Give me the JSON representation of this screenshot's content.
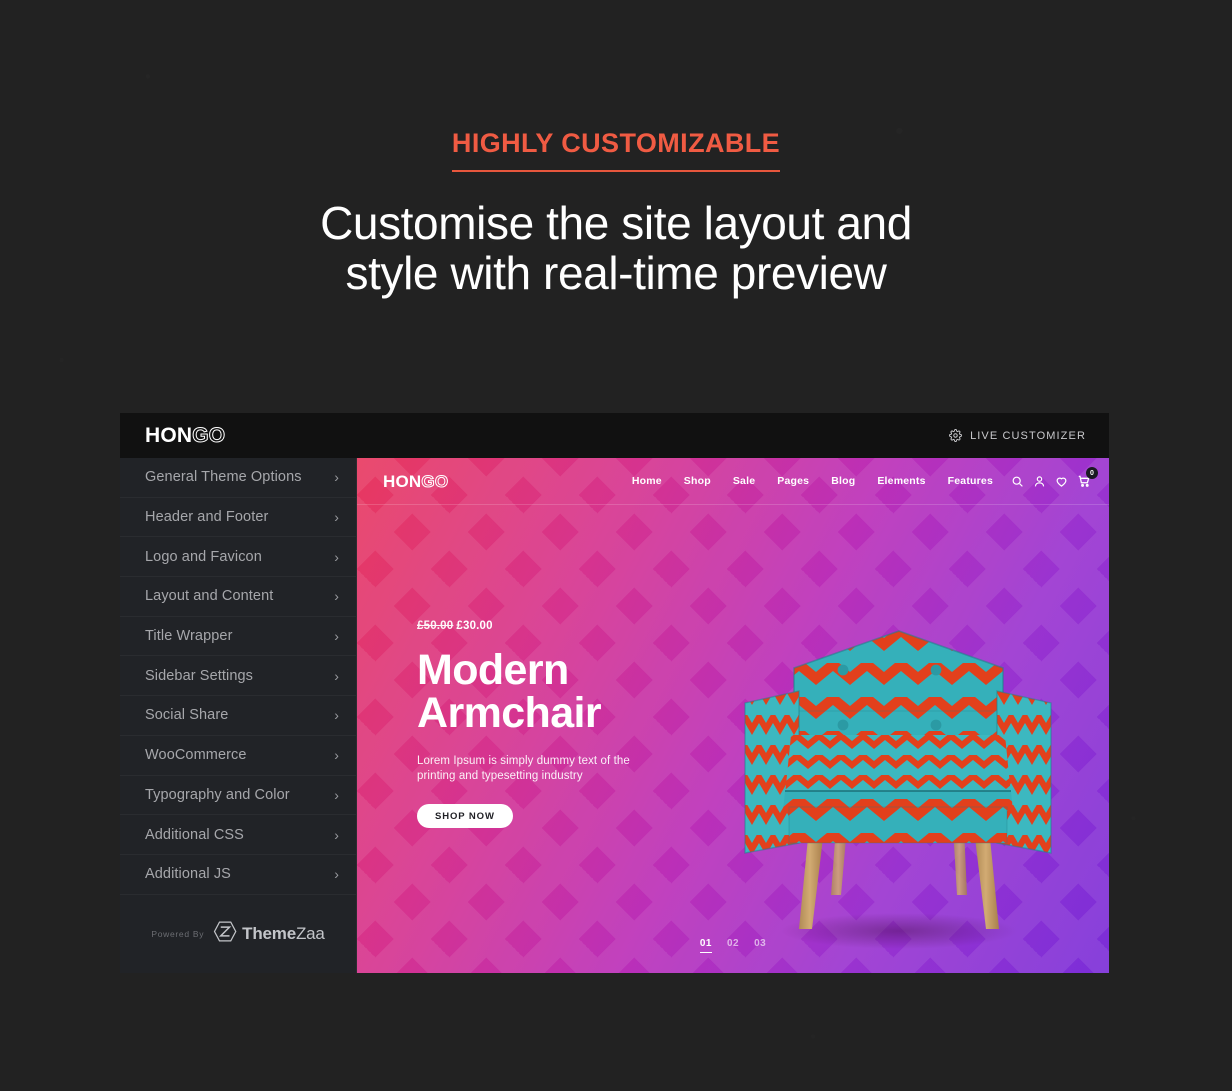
{
  "hero": {
    "eyebrow": "HIGHLY CUSTOMIZABLE",
    "headline_line1": "Customise the site layout and",
    "headline_line2": "style with real-time preview",
    "accent_color": "#f05b43"
  },
  "customizer": {
    "brand": {
      "bold": "HON",
      "outline": "GO"
    },
    "live_customizer_label": "LIVE CUSTOMIZER",
    "gear_icon": "gear-icon",
    "menu": [
      {
        "label": "General Theme Options",
        "chevron": "›"
      },
      {
        "label": "Header and Footer",
        "chevron": "›"
      },
      {
        "label": "Logo and Favicon",
        "chevron": "›"
      },
      {
        "label": "Layout and Content",
        "chevron": "›"
      },
      {
        "label": "Title Wrapper",
        "chevron": "›"
      },
      {
        "label": "Sidebar Settings",
        "chevron": "›"
      },
      {
        "label": "Social Share",
        "chevron": "›"
      },
      {
        "label": "WooCommerce",
        "chevron": "›"
      },
      {
        "label": "Typography and Color",
        "chevron": "›"
      },
      {
        "label": "Additional CSS",
        "chevron": "›"
      },
      {
        "label": "Additional JS",
        "chevron": "›"
      }
    ],
    "footer": {
      "powered_by": "Powered By",
      "brand_bold": "Theme",
      "brand_light": "Zaa",
      "logo_icon": "themezaa-hex-logo-icon"
    }
  },
  "preview": {
    "brand": {
      "bold": "HON",
      "outline": "GO"
    },
    "nav_items": [
      "Home",
      "Shop",
      "Sale",
      "Pages",
      "Blog",
      "Elements",
      "Features"
    ],
    "icons": [
      {
        "name": "search-icon"
      },
      {
        "name": "user-icon"
      },
      {
        "name": "wishlist-heart-icon"
      },
      {
        "name": "cart-icon",
        "badge": "0"
      }
    ],
    "slide": {
      "price_old": "£50.00",
      "price_new": "£30.00",
      "title_line1": "Modern",
      "title_line2": "Armchair",
      "subtitle_line1": "Lorem Ipsum is simply dummy text of the",
      "subtitle_line2": "printing and typesetting industry",
      "cta_label": "SHOP NOW"
    },
    "pagination": [
      {
        "label": "01",
        "active": true
      },
      {
        "label": "02",
        "active": false
      },
      {
        "label": "03",
        "active": false
      }
    ],
    "gradient_start": "#e8395f",
    "gradient_end": "#7b2ed8",
    "product_image": "modern-armchair-chevron-pattern"
  }
}
